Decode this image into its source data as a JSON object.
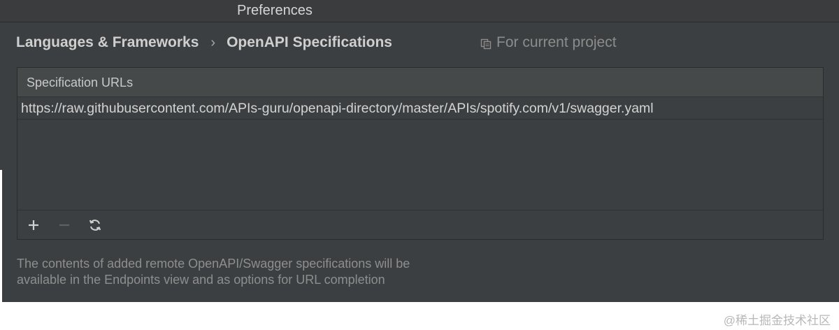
{
  "window": {
    "title": "Preferences"
  },
  "breadcrumb": {
    "parent": "Languages & Frameworks",
    "separator": "›",
    "current": "OpenAPI Specifications"
  },
  "scope": {
    "icon": "copy-icon",
    "label": "For current project"
  },
  "table": {
    "header": "Specification URLs",
    "rows": [
      "https://raw.githubusercontent.com/APIs-guru/openapi-directory/master/APIs/spotify.com/v1/swagger.yaml"
    ]
  },
  "toolbar": {
    "add_icon": "plus-icon",
    "remove_icon": "minus-icon",
    "refresh_icon": "refresh-icon"
  },
  "help": {
    "line1": "The contents of added remote OpenAPI/Swagger specifications will be",
    "line2": "available in the Endpoints view and as options for URL completion"
  },
  "watermark": "@稀土掘金技术社区",
  "colors": {
    "background": "#3c3f41",
    "header_bg": "#45494a",
    "text": "#d3d3d3",
    "muted_text": "#8e8e8e"
  }
}
